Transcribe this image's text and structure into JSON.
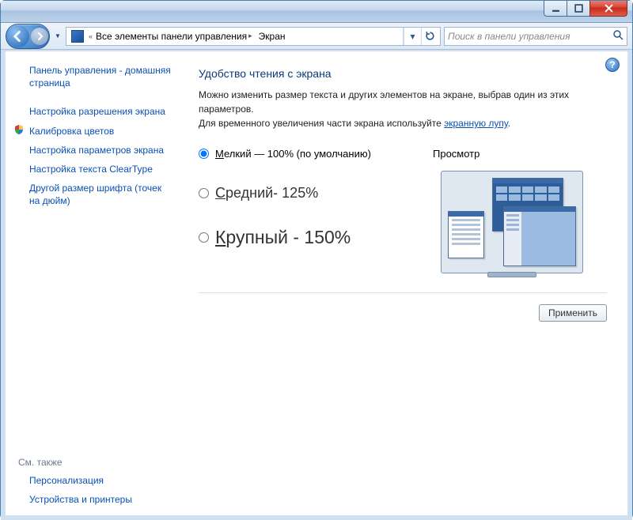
{
  "titlebar": {},
  "address": {
    "chevron_prefix": "«",
    "crumb1": "Все элементы панели управления",
    "crumb2": "Экран"
  },
  "search": {
    "placeholder": "Поиск в панели управления"
  },
  "sidebar": {
    "home": "Панель управления - домашняя страница",
    "items": [
      "Настройка разрешения экрана",
      "Калибровка цветов",
      "Настройка параметров экрана",
      "Настройка текста ClearType",
      "Другой размер шрифта (точек на дюйм)"
    ],
    "seealso_label": "См. также",
    "seealso": [
      "Персонализация",
      "Устройства и принтеры"
    ]
  },
  "main": {
    "title": "Удобство чтения с экрана",
    "desc1": "Можно изменить размер текста и других элементов на экране, выбрав один из этих параметров.",
    "desc2_pre": "Для временного увеличения части экрана используйте ",
    "desc2_link": "экранную лупу",
    "desc2_post": ".",
    "options": {
      "small_pre": "М",
      "small_rest": "елкий — 100% (по умолчанию)",
      "med_pre": "С",
      "med_rest": "редний- 125%",
      "large_pre": "К",
      "large_rest": "рупный - 150%"
    },
    "preview_label": "Просмотр",
    "apply": "Применить"
  }
}
